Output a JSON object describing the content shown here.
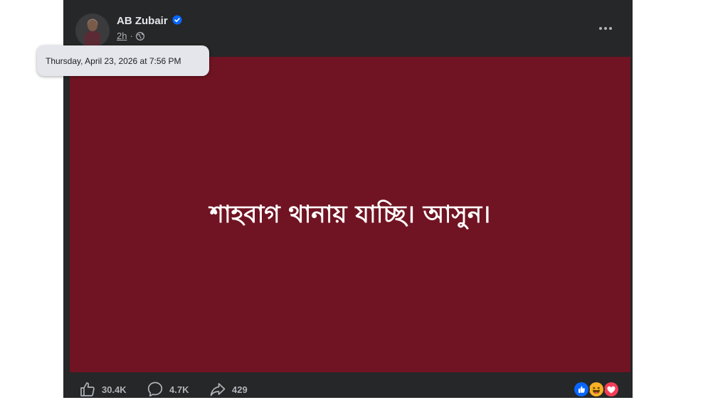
{
  "post": {
    "author": "AB Zubair",
    "time": "2h",
    "separator": "·",
    "text": "শাহবাগ থানায় যাচ্ছি। আসুন।",
    "background_color": "#701322"
  },
  "tooltip": {
    "text": "Thursday, April 23, 2026 at 7:56 PM"
  },
  "actions": {
    "like_count": "30.4K",
    "comment_count": "4.7K",
    "share_count": "429"
  },
  "icons": {
    "verified": "verified-badge-icon",
    "audience": "globe-icon",
    "more": "more-options-icon",
    "like": "thumbs-up-icon",
    "comment": "comment-bubble-icon",
    "share": "share-arrow-icon",
    "reactions": [
      "like-reaction-icon",
      "haha-reaction-icon",
      "love-reaction-icon"
    ]
  },
  "colors": {
    "card": "#252728",
    "verified": "#0866ff",
    "love": "#f33e58",
    "haha": "#f7b125"
  }
}
